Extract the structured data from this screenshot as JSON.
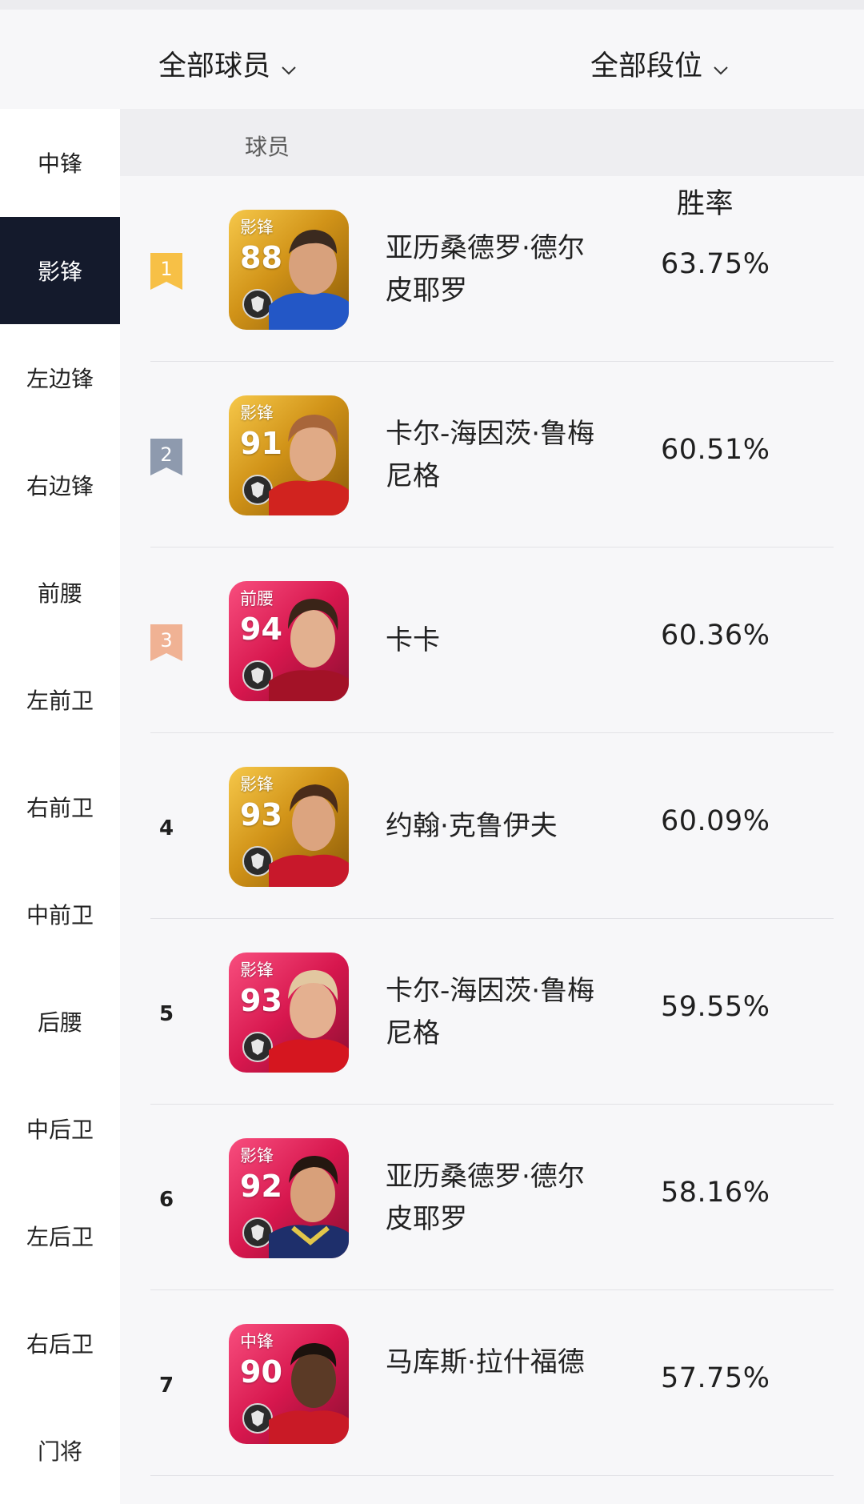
{
  "filters": {
    "players_label": "全部球员",
    "ranks_label": "全部段位",
    "dropdown_icon": "chevron-down-icon"
  },
  "sidebar": {
    "items": [
      {
        "label": "中锋",
        "active": false
      },
      {
        "label": "影锋",
        "active": true
      },
      {
        "label": "左边锋",
        "active": false
      },
      {
        "label": "右边锋",
        "active": false
      },
      {
        "label": "前腰",
        "active": false
      },
      {
        "label": "左前卫",
        "active": false
      },
      {
        "label": "右前卫",
        "active": false
      },
      {
        "label": "中前卫",
        "active": false
      },
      {
        "label": "后腰",
        "active": false
      },
      {
        "label": "中后卫",
        "active": false
      },
      {
        "label": "左后卫",
        "active": false
      },
      {
        "label": "右后卫",
        "active": false
      },
      {
        "label": "门将",
        "active": false
      }
    ],
    "active_color": "#141a2c"
  },
  "table": {
    "header_player": "球员",
    "header_winrate": "胜率",
    "rows": [
      {
        "rank": "1",
        "rank_color": "#f7c046",
        "card_position": "影锋",
        "card_rating": "88",
        "card_style": "gold",
        "name": "亚历桑德罗·德尔皮耶罗",
        "winrate": "63.75%"
      },
      {
        "rank": "2",
        "rank_color": "#8e9aae",
        "card_position": "影锋",
        "card_rating": "91",
        "card_style": "gold",
        "name": "卡尔-海因茨·鲁梅尼格",
        "winrate": "60.51%"
      },
      {
        "rank": "3",
        "rank_color": "#f0b294",
        "card_position": "前腰",
        "card_rating": "94",
        "card_style": "pink",
        "name": "卡卡",
        "winrate": "60.36%"
      },
      {
        "rank": "4",
        "rank_color": "",
        "card_position": "影锋",
        "card_rating": "93",
        "card_style": "gold",
        "name": "约翰·克鲁伊夫",
        "winrate": "60.09%"
      },
      {
        "rank": "5",
        "rank_color": "",
        "card_position": "影锋",
        "card_rating": "93",
        "card_style": "pink",
        "name": "卡尔-海因茨·鲁梅尼格",
        "winrate": "59.55%"
      },
      {
        "rank": "6",
        "rank_color": "",
        "card_position": "影锋",
        "card_rating": "92",
        "card_style": "pink",
        "name": "亚历桑德罗·德尔皮耶罗",
        "winrate": "58.16%"
      },
      {
        "rank": "7",
        "rank_color": "",
        "card_position": "中锋",
        "card_rating": "90",
        "card_style": "pink",
        "name": "马库斯·拉什福德",
        "winrate": "57.75%"
      }
    ]
  }
}
